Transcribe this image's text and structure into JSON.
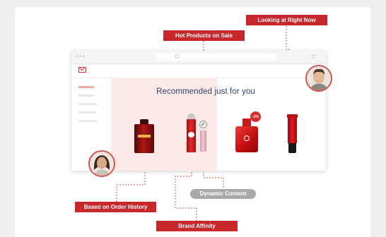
{
  "browser": {
    "heading": "Recommended just for you",
    "discount_badge": "-2%"
  },
  "callouts": {
    "looking_now": "Looking at Right Now",
    "hot_products": "Hot Products on Sale",
    "order_history": "Based on Order History",
    "brand_affinity": "Brand Affinity",
    "dynamic_content": "Dynamic Content"
  },
  "colors": {
    "accent_red": "#c8282b",
    "panel_pink": "#fce9e8",
    "heading_navy": "#2f4369",
    "pill_gray": "#a9a9a9"
  },
  "icons": [
    "mail-icon",
    "search-icon",
    "menu-icon"
  ]
}
